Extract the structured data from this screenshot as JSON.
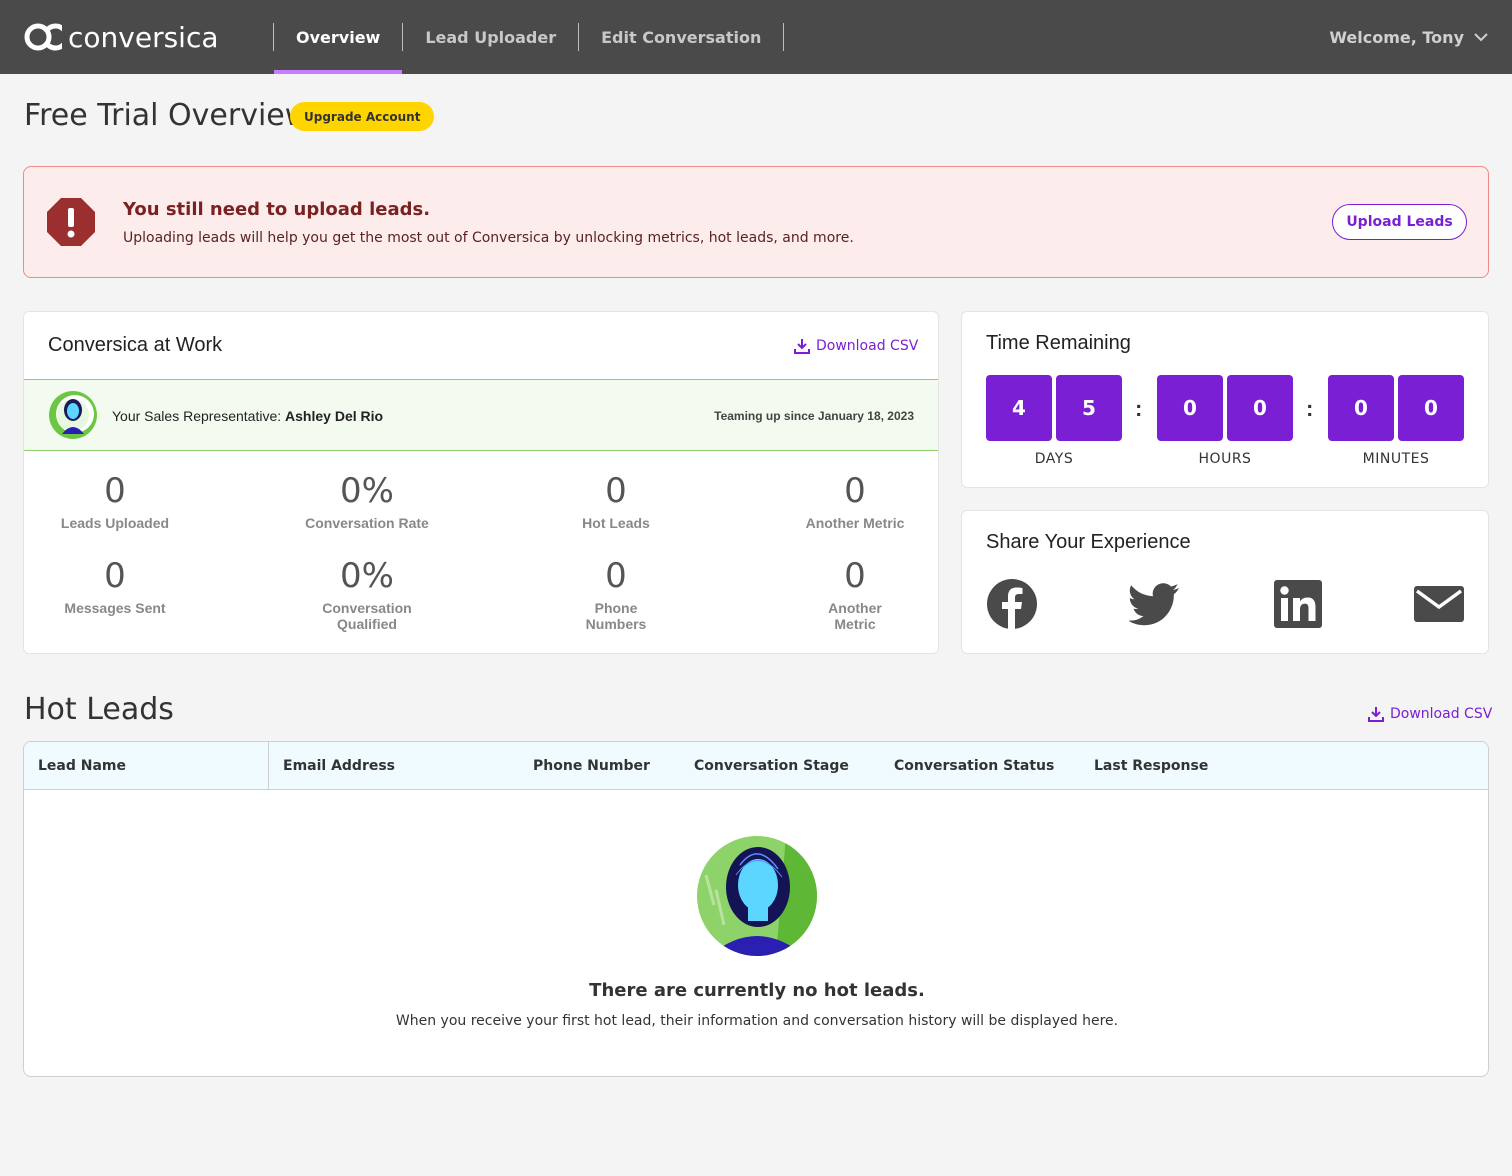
{
  "brand": {
    "name": "conversica",
    "accent": "#7b1fd4",
    "nav_bg": "#4a4a4a"
  },
  "nav": {
    "items": [
      {
        "label": "Overview",
        "active": true
      },
      {
        "label": "Lead Uploader",
        "active": false
      },
      {
        "label": "Edit Conversation",
        "active": false
      }
    ],
    "welcome": "Welcome, Tony"
  },
  "page": {
    "title": "Free Trial Overview",
    "upgrade_label": "Upgrade Account"
  },
  "alert": {
    "title": "You still need to upload leads.",
    "text": "Uploading leads will help you get the most out of Conversica by unlocking metrics, hot leads, and more.",
    "button": "Upload Leads",
    "icon": "alert-octagon-icon"
  },
  "work": {
    "title": "Conversica at Work",
    "download": "Download CSV",
    "rep_prefix": "Your Sales Representative: ",
    "rep_name": "Ashley Del Rio",
    "since": "Teaming up since January 18, 2023",
    "metrics": [
      {
        "value": "0",
        "label": "Leads Uploaded"
      },
      {
        "value": "0%",
        "label": "Conversation Rate"
      },
      {
        "value": "0",
        "label": "Hot Leads"
      },
      {
        "value": "0",
        "label": "Another Metric"
      },
      {
        "value": "0",
        "label": "Messages Sent"
      },
      {
        "value": "0%",
        "label": "Conversation Qualified"
      },
      {
        "value": "0",
        "label": "Phone Numbers"
      },
      {
        "value": "0",
        "label": "Another Metric"
      }
    ]
  },
  "timer": {
    "title": "Time Remaining",
    "digits": [
      "4",
      "5",
      "0",
      "0",
      "0",
      "0"
    ],
    "separator": ":",
    "units": [
      "DAYS",
      "HOURS",
      "MINUTES"
    ]
  },
  "share": {
    "title": "Share Your Experience",
    "icons": [
      "facebook-icon",
      "twitter-icon",
      "linkedin-icon",
      "email-icon"
    ]
  },
  "hot_leads": {
    "title": "Hot Leads",
    "download": "Download CSV",
    "columns": [
      "Lead Name",
      "Email Address",
      "Phone Number",
      "Conversation Stage",
      "Conversation Status",
      "Last Response"
    ],
    "empty_title": "There are currently no hot leads.",
    "empty_text": "When you receive your first hot lead, their information and conversation history will be displayed here."
  }
}
